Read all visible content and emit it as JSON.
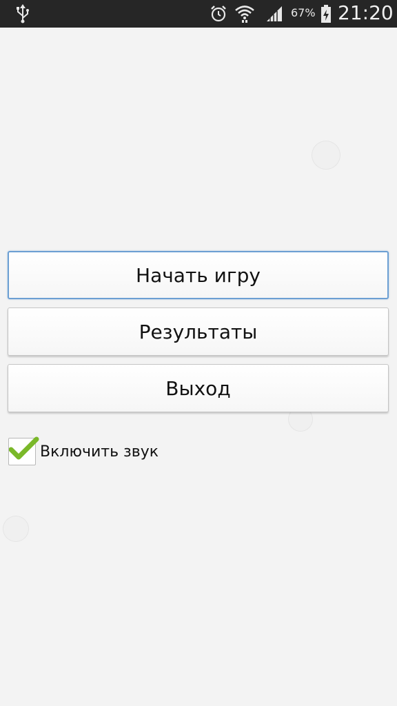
{
  "status_bar": {
    "battery_percent": "67%",
    "time": "21:20",
    "icons": [
      "usb-icon",
      "alarm-icon",
      "wifi-icon",
      "signal-icon",
      "battery-charging-icon"
    ]
  },
  "menu": {
    "start_label": "Начать игру",
    "results_label": "Результаты",
    "exit_label": "Выход"
  },
  "sound_toggle": {
    "label": "Включить звук",
    "checked": true
  },
  "colors": {
    "background": "#f3f3f3",
    "status_bar": "#262626",
    "focus_border": "#6b9fd3",
    "check_green": "#7ab829"
  }
}
